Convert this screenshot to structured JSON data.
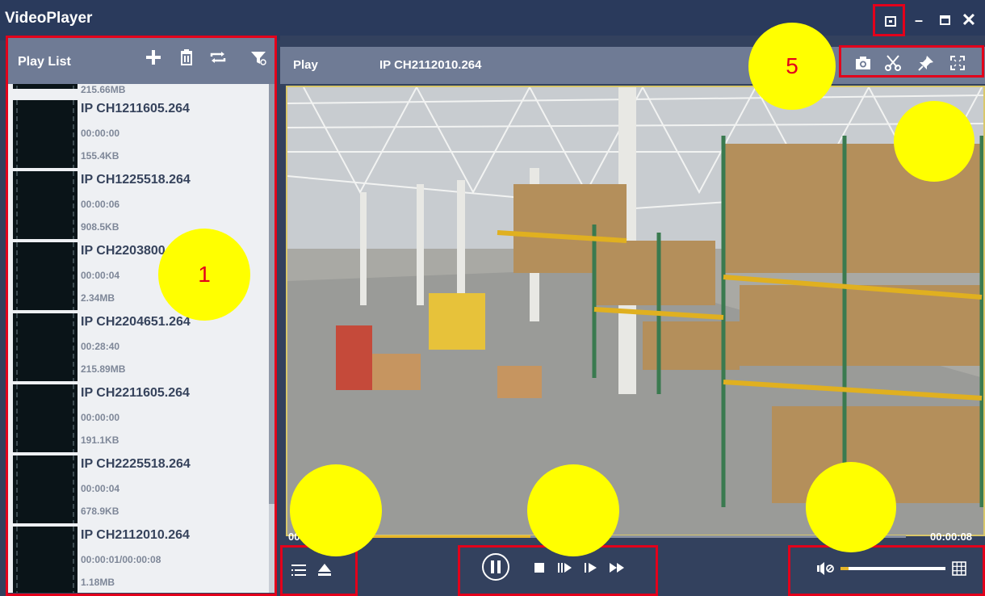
{
  "window": {
    "title": "VideoPlayer",
    "restore_icon": "restore-window-icon",
    "minimize_glyph": "–",
    "close_glyph": "✕"
  },
  "playlist": {
    "title": "Play List",
    "toolbar_icons": [
      "add-icon",
      "delete-icon",
      "loop-icon",
      "filter-icon"
    ],
    "partial_top_size": "215.66MB",
    "items": [
      {
        "name": "IP CH1211605.264",
        "duration": "00:00:00",
        "size": "155.4KB"
      },
      {
        "name": "IP CH1225518.264",
        "duration": "00:00:06",
        "size": "908.5KB"
      },
      {
        "name": "IP CH2203800",
        "duration": "00:00:04",
        "size": "2.34MB"
      },
      {
        "name": "IP CH2204651.264",
        "duration": "00:28:40",
        "size": "215.89MB"
      },
      {
        "name": "IP CH2211605.264",
        "duration": "00:00:00",
        "size": "191.1KB"
      },
      {
        "name": "IP CH2225518.264",
        "duration": "00:00:04",
        "size": "678.9KB"
      },
      {
        "name": "IP CH2112010.264",
        "duration": "00:00:01/00:00:08",
        "size": "1.18MB"
      }
    ]
  },
  "player": {
    "label": "Play",
    "current_file": "IP CH2112010.264",
    "tools": [
      "snapshot-icon",
      "clip-icon",
      "pin-icon",
      "fullscreen-icon"
    ],
    "time_elapsed": "00",
    "time_total": "00:00:08",
    "progress": 0.35
  },
  "controls": {
    "left": [
      "playlist-toggle-icon",
      "eject-icon"
    ],
    "center": [
      "pause-icon",
      "stop-icon",
      "frame-step-icon",
      "slow-forward-icon",
      "fast-forward-icon"
    ],
    "right": [
      "volume-icon",
      "grid-layout-icon"
    ],
    "volume_level": 0.08
  },
  "annotations": {
    "callout_1": "1",
    "callout_5": "5",
    "highlight_color": "#e3001b",
    "callout_color": "#ffff00"
  }
}
